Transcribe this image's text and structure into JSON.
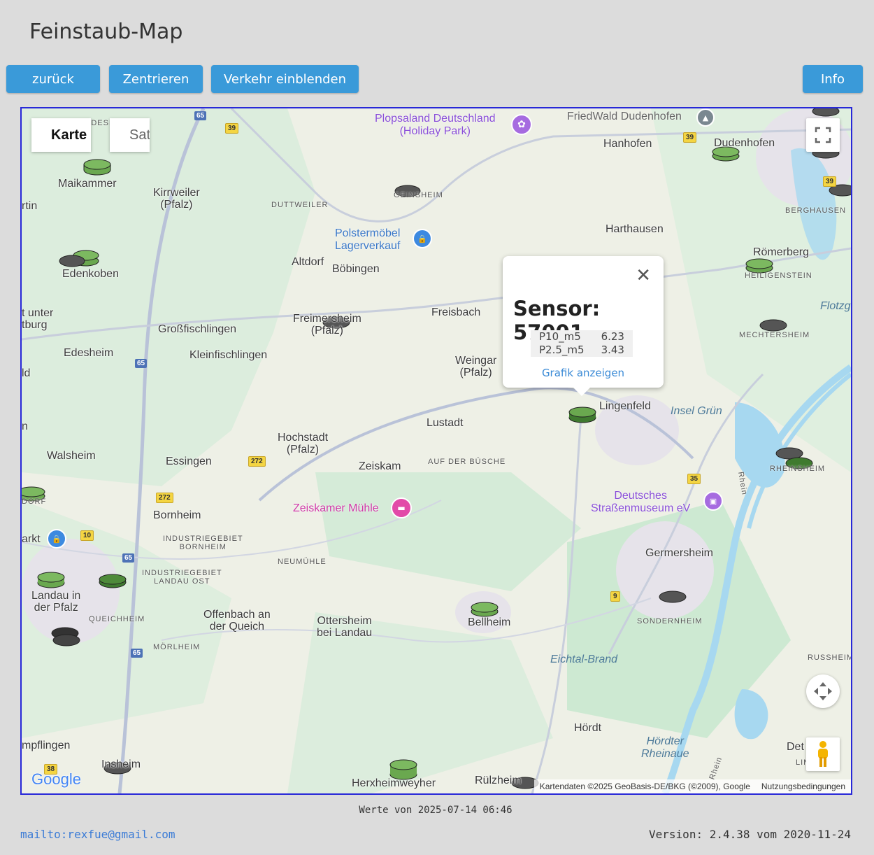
{
  "page": {
    "title": "Feinstaub-Map"
  },
  "toolbar": {
    "back": "zurück",
    "center": "Zentrieren",
    "traffic": "Verkehr einblenden",
    "info": "Info"
  },
  "map": {
    "type_controls": {
      "map": "Karte",
      "satellite": "Satellit"
    },
    "places": {
      "diedesfeld": "DIEDESF",
      "maikammer": "Maikammer",
      "kirrweiler": "Kirrweiler\n(Pfalz)",
      "duttweiler": "DUTTWEILER",
      "geinsheim": "GEINSHEIM",
      "hanhofen": "Hanhofen",
      "dudenhofen": "Dudenhofen",
      "berghausen": "BERGHAUSEN",
      "harthausen": "Harthausen",
      "roemerberg": "Römerberg",
      "heiligenstein": "HEILIGENSTEIN",
      "mechtersheim": "MECHTERSHEIM",
      "flotzgruen": "Flotzg",
      "rtin": "rtin",
      "edenkoben": "Edenkoben",
      "altdorf": "Altdorf",
      "boebingen": "Böbingen",
      "tunter": "t unter\ntburg",
      "grossfischlingen": "Großfischlingen",
      "freimersheim": "Freimersheim\n(Pfalz)",
      "freisbach": "Freisbach",
      "edesheim": "Edesheim",
      "kleinfischlingen": "Kleinfischlingen",
      "weingarten": "Weingar\n(Pfalz)",
      "ld": "ld",
      "n": "n",
      "lingenfeld": "Lingenfeld",
      "inselgruen": "Insel Grün",
      "lustadt": "Lustadt",
      "hochstadt": "Hochstadt\n(Pfalz)",
      "walsheim": "Walsheim",
      "essingen": "Essingen",
      "zeiskam": "Zeiskam",
      "aufderbuesche": "AUF DER BÜSCHE",
      "rheinsheim": "RHEINSHEIM",
      "dorf": "DORF",
      "bornheim": "Bornheim",
      "ind_bornheim": "INDUSTRIEGEBIET\nBORNHEIM",
      "arkt": "arkt",
      "neumuehle": "NEUMÜHLE",
      "ind_landau": "INDUSTRIEGEBIET\nLANDAU OST",
      "germersheim": "Germersheim",
      "landau": "Landau in\nder Pfalz",
      "queichheim": "QUEICHHEIM",
      "offenbach": "Offenbach an\nder Queich",
      "ottersheim": "Ottersheim\nbei Landau",
      "bellheim": "Bellheim",
      "sondernheim": "SONDERNHEIM",
      "moerlheim": "MÖRLHEIM",
      "eichtalbrand": "Eichtal-Brand",
      "russheim": "RUSSHEIM",
      "hoerdt": "Hördt",
      "hoerdter": "Hördter\nRheinaue",
      "mpflingen": "mpflingen",
      "insheim": "Insheim",
      "herxheim": "Herxheimweyher",
      "ruelzheim": "Rülzheim",
      "det": "Det",
      "lin": "LIN",
      "rhein1": "Rhein",
      "rhein2": "Rhein"
    },
    "pois": {
      "plopsaland": "Plopsaland Deutschland\n(Holiday Park)",
      "friedwald": "FriedWald Dudenhofen",
      "polstermoebel": "Polstermöbel\nLagerverkauf",
      "zeiskamer": "Zeiskamer Mühle",
      "museum": "Deutsches\nStraßenmuseum eV"
    },
    "roads": [
      "65",
      "39",
      "39",
      "39",
      "65",
      "272",
      "272",
      "10",
      "65",
      "65",
      "35",
      "9",
      "38"
    ],
    "popup": {
      "title": "Sensor: 57001",
      "rows": [
        {
          "name": "P10_m5",
          "value": "6.23"
        },
        {
          "name": "P2.5_m5",
          "value": "3.43"
        }
      ],
      "link": "Grafik anzeigen"
    },
    "attribution": "Kartendaten ©2025 GeoBasis-DE/BKG (©2009), Google",
    "terms": "Nutzungsbedingungen",
    "google_logo": "Google",
    "colors": {
      "sensor_green": "#6aa84f",
      "sensor_dark_green": "#3f7a2f",
      "sensor_gray": "#555555",
      "water": "#a7d8f0",
      "border": "#2828d8"
    }
  },
  "footer": {
    "timestamp": "Werte von 2025-07-14 06:46",
    "mail": "mailto:rexfue@gmail.com",
    "version": "Version: 2.4.38 vom 2020-11-24"
  }
}
